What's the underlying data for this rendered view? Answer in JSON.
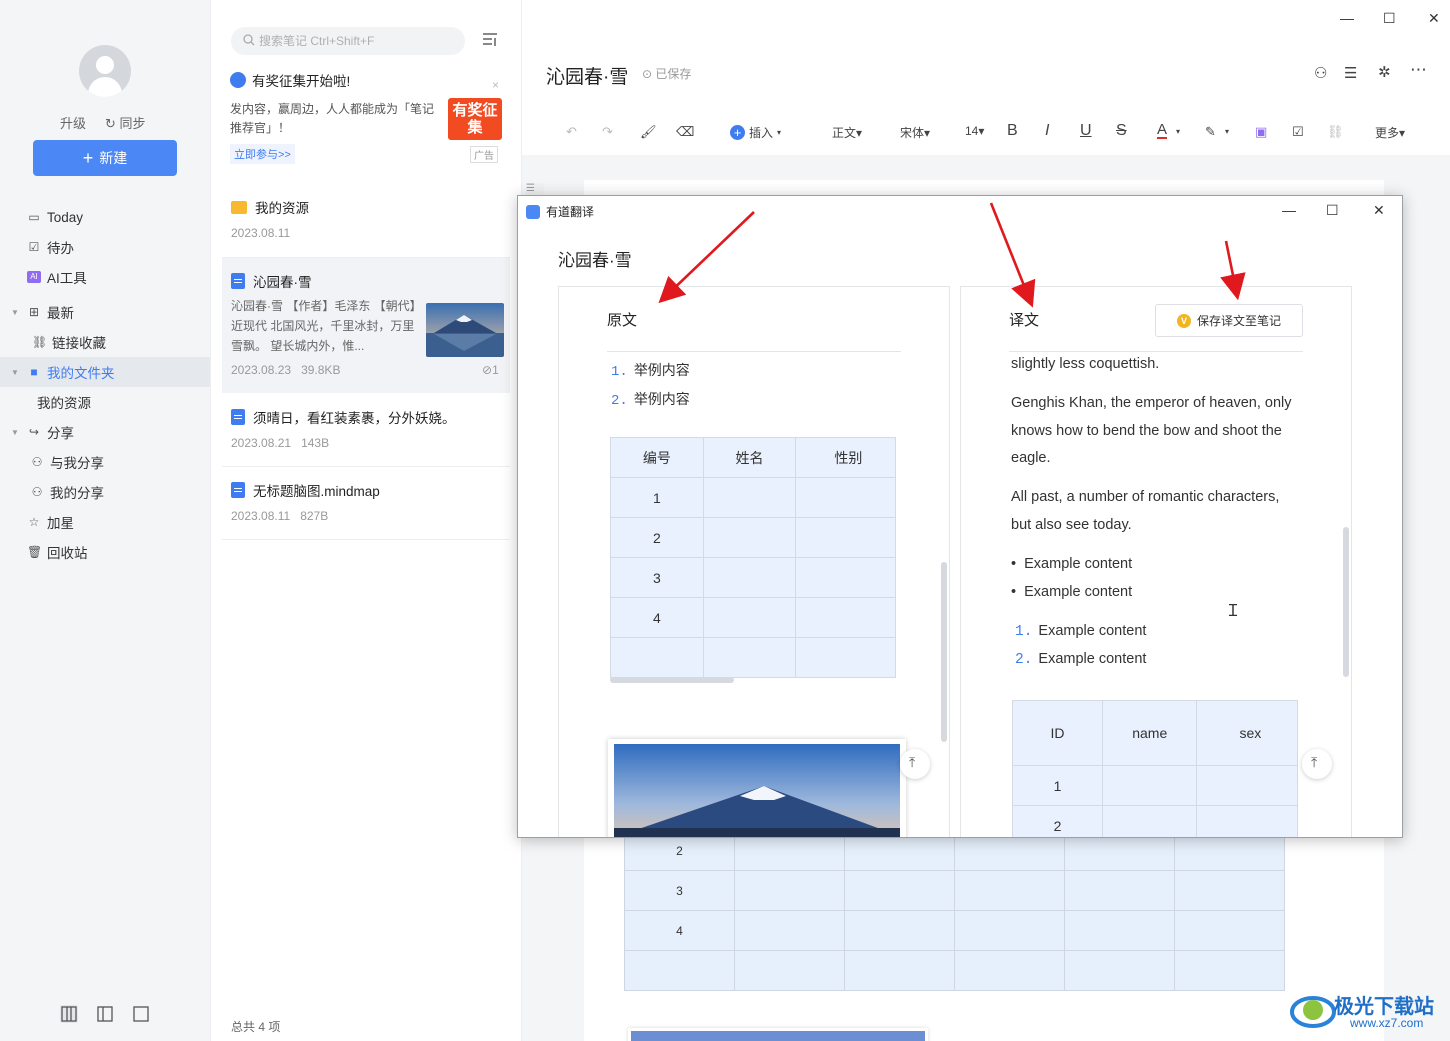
{
  "sidebar": {
    "upgrade": "升级",
    "sync": "同步",
    "new_button": "新建",
    "nav": [
      {
        "label": "Today"
      },
      {
        "label": "待办"
      },
      {
        "label": "AI工具"
      },
      {
        "label": "最新"
      },
      {
        "label": "链接收藏"
      },
      {
        "label": "我的文件夹"
      },
      {
        "label": "我的资源"
      },
      {
        "label": "分享"
      },
      {
        "label": "与我分享"
      },
      {
        "label": "我的分享"
      },
      {
        "label": "加星"
      },
      {
        "label": "回收站"
      }
    ]
  },
  "notelist": {
    "search_placeholder": "搜索笔记 Ctrl+Shift+F",
    "ad": {
      "title": "有奖征集开始啦!",
      "text": "发内容，赢周边，人人都能成为「笔记推荐官」！",
      "link": "立即参与>>",
      "image_text": "有奖征集",
      "tag": "广告"
    },
    "notes": [
      {
        "title": "我的资源",
        "date": "2023.08.11",
        "size": ""
      },
      {
        "title": "沁园春·雪",
        "snippet": "沁园春·雪 【作者】毛泽东 【朝代】近现代 北国风光，千里冰封，万里雪飘。 望长城内外，惟...",
        "date": "2023.08.23",
        "size": "39.8KB",
        "attach": "1"
      },
      {
        "title": "须晴日，看红装素裹，分外妖娆。",
        "date": "2023.08.21",
        "size": "143B"
      },
      {
        "title": "无标题脑图.mindmap",
        "date": "2023.08.11",
        "size": "827B"
      }
    ],
    "total": "总共 4 项"
  },
  "editor": {
    "title": "沁园春·雪",
    "saved": "已保存",
    "toolbar": {
      "insert": "插入",
      "style": "正文",
      "font": "宋体",
      "size": "14",
      "more": "更多"
    },
    "bg_table_rows": [
      "2",
      "3",
      "4",
      ""
    ]
  },
  "translator": {
    "window_title": "有道翻译",
    "doc_title": "沁园春·雪",
    "source": {
      "header": "原文",
      "list": [
        "举例内容",
        "举例内容"
      ],
      "table_header": [
        "编号",
        "姓名",
        "性别"
      ],
      "table_rows": [
        "1",
        "2",
        "3",
        "4",
        ""
      ]
    },
    "target": {
      "header": "译文",
      "save_button": "保存译文至笔记",
      "paragraphs": [
        "slightly less coquettish.",
        "Genghis Khan, the emperor of heaven, only knows how to bend the bow and shoot the eagle.",
        "All past, a number of romantic characters, but also see today."
      ],
      "bullets": [
        "Example content",
        "Example content"
      ],
      "numbered": [
        "Example content",
        "Example content"
      ],
      "table_header": [
        "ID",
        "name",
        "sex"
      ],
      "table_rows": [
        "1",
        "2"
      ]
    }
  },
  "watermark": {
    "text": "极光下载站",
    "url": "www.xz7.com"
  },
  "colors": {
    "accent": "#4c87f6",
    "arrow": "#e0191f",
    "table_fill": "#e8f1fd"
  }
}
